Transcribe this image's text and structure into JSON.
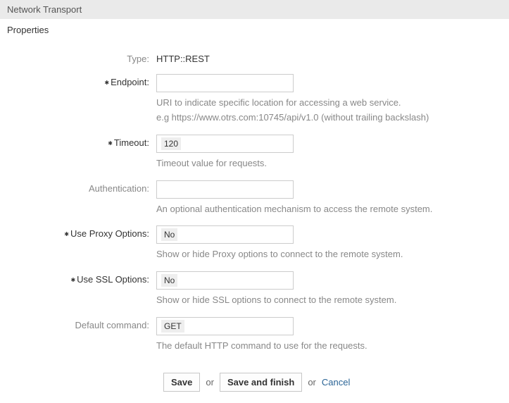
{
  "header": {
    "title": "Network Transport"
  },
  "section": {
    "title": "Properties"
  },
  "form": {
    "type": {
      "label": "Type:",
      "value": "HTTP::REST"
    },
    "endpoint": {
      "label": "Endpoint:",
      "value": "",
      "hint1": "URI to indicate specific location for accessing a web service.",
      "hint2": "e.g https://www.otrs.com:10745/api/v1.0 (without trailing backslash)"
    },
    "timeout": {
      "label": "Timeout:",
      "value": "120",
      "hint": "Timeout value for requests."
    },
    "authentication": {
      "label": "Authentication:",
      "value": "",
      "hint": "An optional authentication mechanism to access the remote system."
    },
    "useProxy": {
      "label": "Use Proxy Options:",
      "value": "No",
      "hint": "Show or hide Proxy options to connect to the remote system."
    },
    "useSSL": {
      "label": "Use SSL Options:",
      "value": "No",
      "hint": "Show or hide SSL options to connect to the remote system."
    },
    "defaultCommand": {
      "label": "Default command:",
      "value": "GET",
      "hint": "The default HTTP command to use for the requests."
    }
  },
  "actions": {
    "save": "Save",
    "or1": "or",
    "saveFinish": "Save and finish",
    "or2": "or",
    "cancel": "Cancel"
  }
}
